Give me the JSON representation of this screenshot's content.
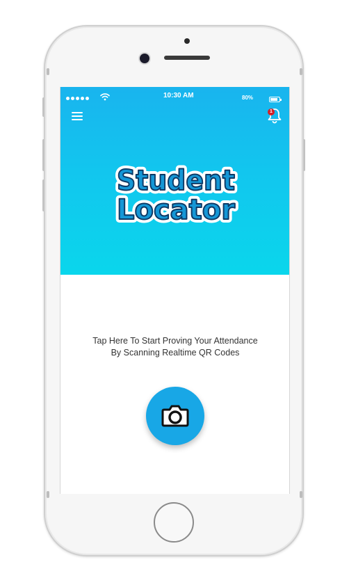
{
  "status_bar": {
    "time": "10:30 AM",
    "battery_percent": "80%",
    "battery_level": 0.8,
    "signal_icon": "signal-dots-icon",
    "wifi_icon": "wifi-icon"
  },
  "toolbar": {
    "menu_icon": "hamburger-menu-icon",
    "notification_icon": "bell-icon",
    "notification_count": "1"
  },
  "logo": {
    "line1": "Student",
    "line2": "Locator"
  },
  "main": {
    "prompt": "Tap Here To Start Proving Your Attendance By Scanning Realtime QR Codes",
    "scan_icon": "camera-icon"
  },
  "colors": {
    "header_top": "#19b4ee",
    "header_bottom": "#0ad6ec",
    "accent": "#18a7e6",
    "badge": "#d32128"
  }
}
